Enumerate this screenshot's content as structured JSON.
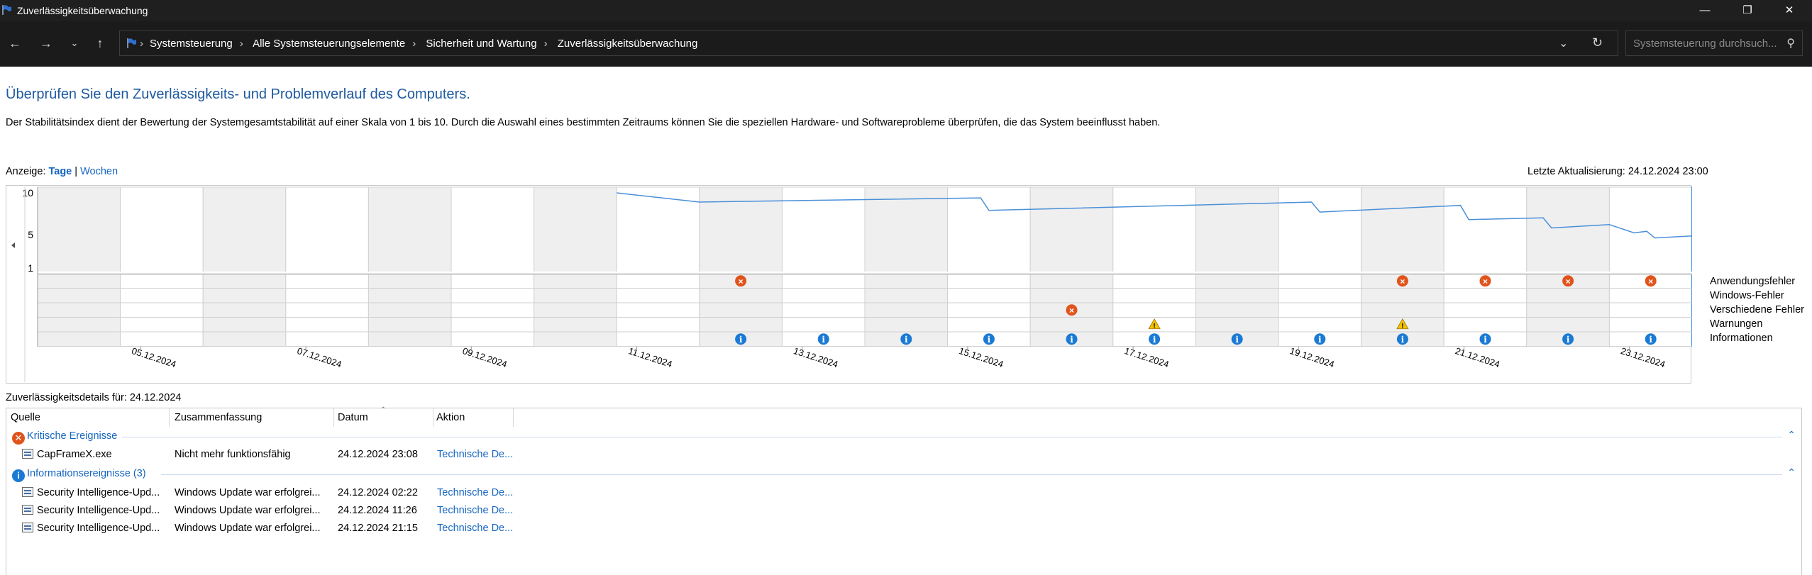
{
  "window": {
    "title": "Zuverlässigkeitsüberwachung"
  },
  "address": {
    "crumbs": [
      "Systemsteuerung",
      "Alle Systemsteuerungselemente",
      "Sicherheit und Wartung",
      "Zuverlässigkeitsüberwachung"
    ],
    "search_placeholder": "Systemsteuerung durchsuch..."
  },
  "page": {
    "heading": "Überprüfen Sie den Zuverlässigkeits- und Problemverlauf des Computers.",
    "description": "Der Stabilitätsindex dient der Bewertung der Systemgesamtstabilität auf einer Skala von 1 bis 10. Durch die Auswahl eines bestimmten Zeitraums können Sie die speziellen Hardware- und Softwareprobleme überprüfen, die das System beeinflusst haben.",
    "view_label": "Anzeige:",
    "view_days": "Tage",
    "view_divider": "|",
    "view_weeks": "Wochen",
    "last_update": "Letzte Aktualisierung: 24.12.2024 23:00"
  },
  "chart_data": {
    "type": "line",
    "ylim": [
      1,
      10
    ],
    "y_ticks": [
      "10",
      "5",
      "1"
    ],
    "columns": [
      "04.12.2024",
      "05.12.2024",
      "06.12.2024",
      "07.12.2024",
      "08.12.2024",
      "09.12.2024",
      "10.12.2024",
      "11.12.2024",
      "12.12.2024",
      "13.12.2024",
      "14.12.2024",
      "15.12.2024",
      "16.12.2024",
      "17.12.2024",
      "18.12.2024",
      "19.12.2024",
      "20.12.2024",
      "21.12.2024",
      "22.12.2024",
      "23.12.2024",
      "24.12.2024"
    ],
    "x_tick_labels": [
      "05.12.2024",
      "07.12.2024",
      "09.12.2024",
      "11.12.2024",
      "13.12.2024",
      "15.12.2024",
      "17.12.2024",
      "19.12.2024",
      "21.12.2024",
      "23.12.2024"
    ],
    "selected_column": "24.12.2024",
    "stability_index": [
      {
        "x": 7.0,
        "y": 10.0
      },
      {
        "x": 8.0,
        "y": 8.9
      },
      {
        "x": 11.4,
        "y": 9.4
      },
      {
        "x": 11.5,
        "y": 7.9
      },
      {
        "x": 15.4,
        "y": 8.9
      },
      {
        "x": 15.5,
        "y": 7.7
      },
      {
        "x": 17.2,
        "y": 8.5
      },
      {
        "x": 17.3,
        "y": 6.8
      },
      {
        "x": 18.2,
        "y": 7.0
      },
      {
        "x": 18.3,
        "y": 5.8
      },
      {
        "x": 19.0,
        "y": 6.2
      },
      {
        "x": 19.3,
        "y": 5.2
      },
      {
        "x": 19.45,
        "y": 5.4
      },
      {
        "x": 19.55,
        "y": 4.6
      },
      {
        "x": 20.3,
        "y": 5.0
      },
      {
        "x": 20.5,
        "y": 4.6
      },
      {
        "x": 20.95,
        "y": 5.1
      },
      {
        "x": 21.0,
        "y": 4.4
      }
    ],
    "categories": [
      "Anwendungsfehler",
      "Windows-Fehler",
      "Verschiedene Fehler",
      "Warnungen",
      "Informationen"
    ],
    "events": {
      "Anwendungsfehler": [
        "12.12.2024",
        "20.12.2024",
        "21.12.2024",
        "22.12.2024",
        "23.12.2024",
        "24.12.2024"
      ],
      "Windows-Fehler": [],
      "Verschiedene Fehler": [
        "16.12.2024"
      ],
      "Warnungen": [
        "17.12.2024",
        "20.12.2024"
      ],
      "Informationen": [
        "12.12.2024",
        "13.12.2024",
        "14.12.2024",
        "15.12.2024",
        "16.12.2024",
        "17.12.2024",
        "18.12.2024",
        "19.12.2024",
        "20.12.2024",
        "21.12.2024",
        "22.12.2024",
        "23.12.2024",
        "24.12.2024"
      ]
    },
    "colors": {
      "line": "#4a90d9",
      "error": "#e0541b",
      "warning": "#f2c200",
      "info": "#1a7ad4",
      "selected": "#bcdcf5",
      "shaded": "#efefef"
    }
  },
  "details": {
    "label": "Zuverlässigkeitsdetails für: 24.12.2024",
    "columns": [
      "Quelle",
      "Zusammenfassung",
      "Datum",
      "Aktion"
    ],
    "groups": [
      {
        "title": "Kritische Ereignisse",
        "icon": "error-icon",
        "rows": [
          {
            "source": "CapFrameX.exe",
            "summary": "Nicht mehr funktionsfähig",
            "date": "24.12.2024 23:08",
            "action": "Technische De..."
          }
        ]
      },
      {
        "title": "Informationsereignisse (3)",
        "icon": "info-icon",
        "rows": [
          {
            "source": "Security Intelligence-Upd...",
            "summary": "Windows Update war erfolgrei...",
            "date": "24.12.2024 02:22",
            "action": "Technische De..."
          },
          {
            "source": "Security Intelligence-Upd...",
            "summary": "Windows Update war erfolgrei...",
            "date": "24.12.2024 11:26",
            "action": "Technische De..."
          },
          {
            "source": "Security Intelligence-Upd...",
            "summary": "Windows Update war erfolgrei...",
            "date": "24.12.2024 21:15",
            "action": "Technische De..."
          }
        ]
      }
    ]
  }
}
